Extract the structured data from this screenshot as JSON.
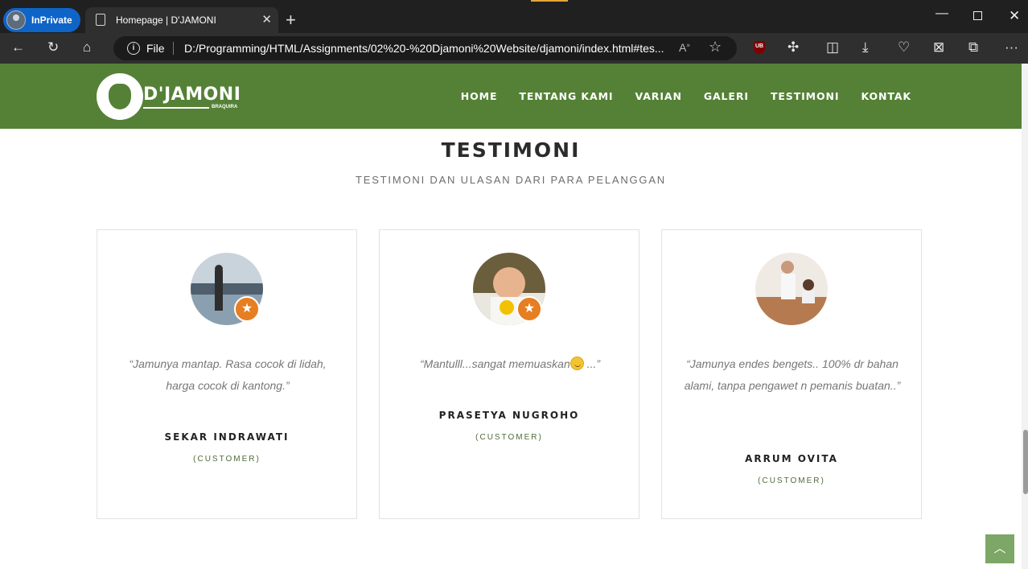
{
  "browser": {
    "private_label": "InPrivate",
    "tab_title": "Homepage | D'JAMONI",
    "address_scheme": "File",
    "address_url": "D:/Programming/HTML/Assignments/02%20-%20Djamoni%20Website/djamoni/index.html#tes...",
    "ublock_label": "UB"
  },
  "site": {
    "brand": "D'JAMONI",
    "brand_sub": "BRAQUIRA",
    "menu": [
      "HOME",
      "TENTANG KAMI",
      "VARIAN",
      "GALERI",
      "TESTIMONI",
      "KONTAK"
    ],
    "section_title": "TESTIMONI",
    "section_subtitle": "TESTIMONI DAN ULASAN DARI PARA PELANGGAN",
    "testimonials": [
      {
        "quote": "“Jamunya mantap. Rasa cocok di lidah, harga cocok di kantong.”",
        "name": "SEKAR INDRAWATI",
        "role": "(CUSTOMER)"
      },
      {
        "quote": "“Mantulll...sangat memuaskan",
        "quote_end": " ...”",
        "name": "PRASETYA NUGROHO",
        "role": "(CUSTOMER)"
      },
      {
        "quote": "“Jamunya endes bengets.. 100% dr bahan alami, tanpa pengawet n pemanis buatan..”",
        "name": "ARRUM OVITA",
        "role": "(CUSTOMER)"
      }
    ]
  },
  "colors": {
    "navbar": "#548136",
    "badge": "#e67e22",
    "back_to_top": "#7ca766"
  }
}
